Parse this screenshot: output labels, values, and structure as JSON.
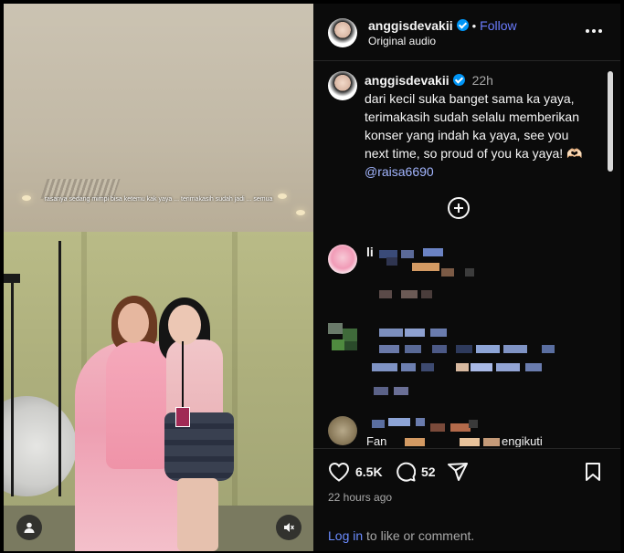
{
  "post": {
    "username": "anggisdevakii",
    "follow_label": "Follow",
    "audio_label": "Original audio",
    "caption_time": "22h",
    "caption_text": "dari kecil suka banget sama ka yaya, terimakasih sudah selalu memberikan konser yang indah ka yaya, see you next time, so proud of you ka yaya! 🫶🏻",
    "caption_mention": "@raisa6690",
    "media_overlay_text": "rasanya sedang mimpi bisa ketemu kak yaya ... terimakasih sudah jadi ... semua"
  },
  "comments": [
    {
      "visible_prefix": "li"
    },
    {
      "visible_prefix": ""
    },
    {
      "visible_prefix": "Fan",
      "visible_suffix": "engikuti"
    }
  ],
  "actions": {
    "likes": "6.5K",
    "comments_count": "52",
    "posted_ago": "22 hours ago",
    "login_link": "Log in",
    "login_rest": " to like or comment."
  },
  "icons": {
    "like": "heart-icon",
    "comment": "comment-icon",
    "share": "share-icon",
    "save": "bookmark-icon",
    "more": "more-options-icon",
    "user_tag": "user-tag-icon",
    "mute": "mute-icon",
    "add_comment": "load-more-comments-icon"
  },
  "colors": {
    "panel_bg": "#0b0b0b",
    "follow": "#6b7cff",
    "verified": "#0095f6",
    "link": "#6b8cff"
  }
}
